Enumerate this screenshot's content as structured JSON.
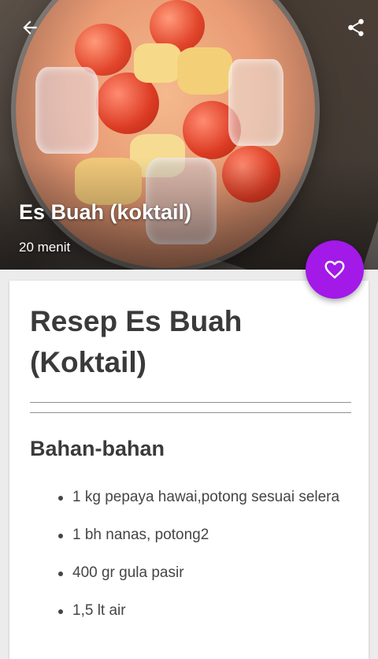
{
  "header": {
    "title": "Es Buah (koktail)",
    "time": "20 menit",
    "back_icon": "arrow-left-icon",
    "share_icon": "share-icon",
    "favorite_icon": "heart-outline-icon"
  },
  "recipe": {
    "title": "Resep Es Buah (Koktail)",
    "ingredients_title": "Bahan-bahan",
    "ingredients": [
      "1 kg pepaya hawai,potong sesuai selera",
      "1 bh nanas, potong2",
      "400 gr gula pasir",
      "1,5 lt air"
    ]
  },
  "colors": {
    "accent": "#a219e8",
    "text": "#3a3a3a",
    "background": "#ececec"
  }
}
